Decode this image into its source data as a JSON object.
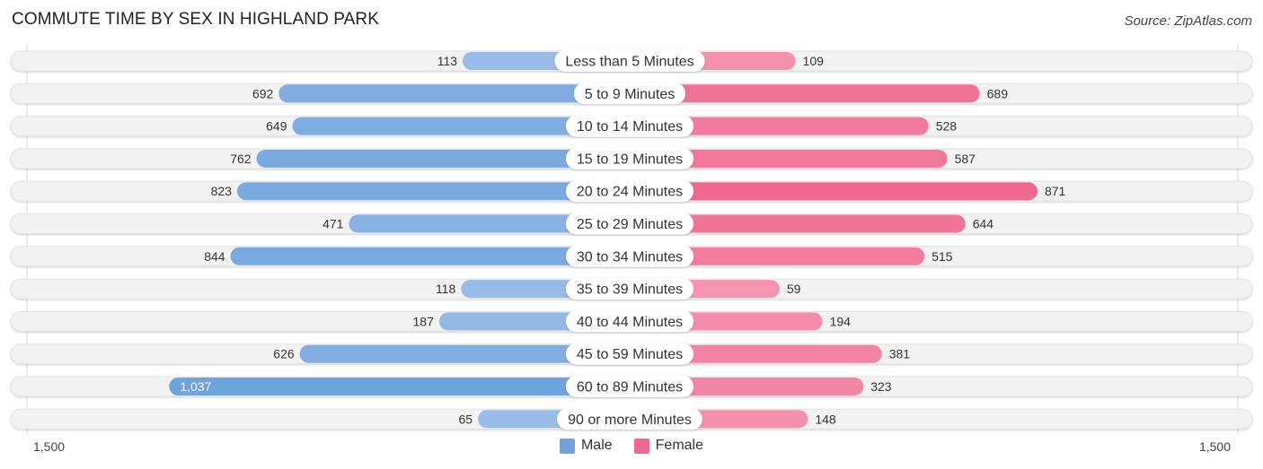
{
  "header": {
    "title": "COMMUTE TIME BY SEX IN HIGHLAND PARK",
    "source": "Source: ZipAtlas.com"
  },
  "colors": {
    "male": "#6fa3dd",
    "male_light": "#aac8ec",
    "female": "#f06890",
    "female_light": "#f7a6bf",
    "track": "#f2f2f2",
    "label_pill": "#ffffff"
  },
  "legend": {
    "male_label": "Male",
    "female_label": "Female"
  },
  "axis": {
    "left_label": "1,500",
    "right_label": "1,500"
  },
  "chart_data": {
    "type": "bar",
    "orientation": "horizontal-diverging",
    "title": "COMMUTE TIME BY SEX IN HIGHLAND PARK",
    "xlabel": "",
    "ylabel": "",
    "xlim": [
      -1500,
      1500
    ],
    "legend_position": "bottom-center",
    "categories": [
      "Less than 5 Minutes",
      "5 to 9 Minutes",
      "10 to 14 Minutes",
      "15 to 19 Minutes",
      "20 to 24 Minutes",
      "25 to 29 Minutes",
      "30 to 34 Minutes",
      "35 to 39 Minutes",
      "40 to 44 Minutes",
      "45 to 59 Minutes",
      "60 to 89 Minutes",
      "90 or more Minutes"
    ],
    "series": [
      {
        "name": "Male",
        "side": "left",
        "values": [
          113,
          692,
          649,
          762,
          823,
          471,
          844,
          118,
          187,
          626,
          1037,
          65
        ],
        "labels": [
          "113",
          "692",
          "649",
          "762",
          "823",
          "471",
          "844",
          "118",
          "187",
          "626",
          "1,037",
          "65"
        ]
      },
      {
        "name": "Female",
        "side": "right",
        "values": [
          109,
          689,
          528,
          587,
          871,
          644,
          515,
          59,
          194,
          381,
          323,
          148
        ],
        "labels": [
          "109",
          "689",
          "528",
          "587",
          "871",
          "644",
          "515",
          "59",
          "194",
          "381",
          "323",
          "148"
        ]
      }
    ]
  }
}
